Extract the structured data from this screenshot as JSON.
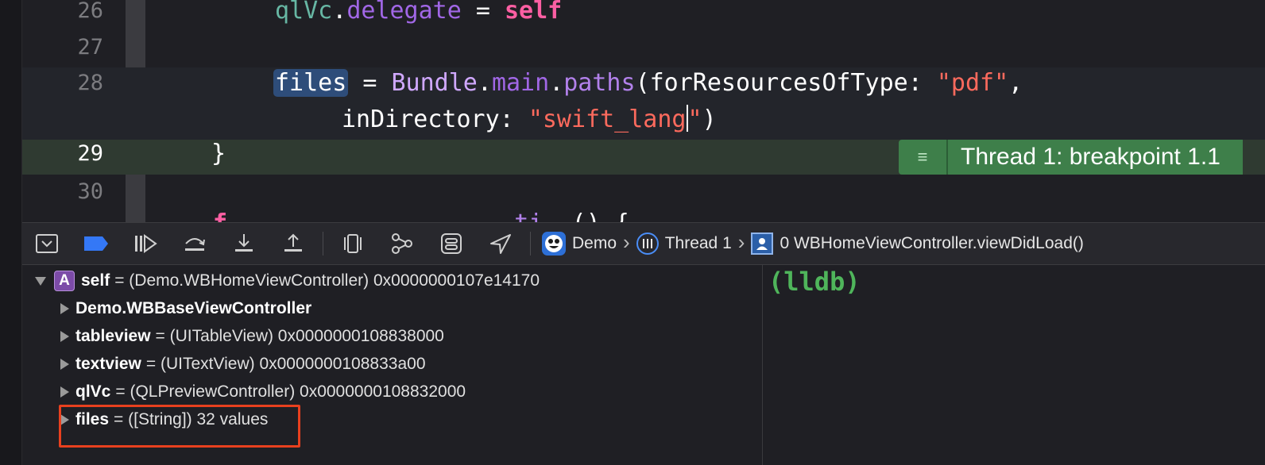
{
  "editor": {
    "lines": [
      {
        "num": "26",
        "tokens": [
          [
            "var",
            "qlVc"
          ],
          [
            "plain",
            "."
          ],
          [
            "prop",
            "delegate"
          ],
          [
            "plain",
            " = "
          ],
          [
            "kw",
            "self"
          ]
        ]
      },
      {
        "num": "27",
        "tokens": []
      },
      {
        "num": "28",
        "tokens": [
          [
            "hlvar",
            "files"
          ],
          [
            "plain",
            " = "
          ],
          [
            "cls",
            "Bundle"
          ],
          [
            "plain",
            "."
          ],
          [
            "prop",
            "main"
          ],
          [
            "plain",
            "."
          ],
          [
            "fn",
            "paths"
          ],
          [
            "plain",
            "(forResourcesOfType: "
          ],
          [
            "str",
            "\"pdf\""
          ],
          [
            "plain",
            ","
          ]
        ]
      },
      {
        "num": "",
        "tokens": [
          [
            "plain",
            "inDirectory: "
          ],
          [
            "str",
            "\"swift_lang"
          ],
          [
            "caret",
            ""
          ],
          [
            "str",
            "\""
          ],
          [
            "plain",
            ")"
          ]
        ]
      },
      {
        "num": "29",
        "tokens": [
          [
            "plain",
            "}"
          ]
        ]
      },
      {
        "num": "30",
        "tokens": []
      },
      {
        "num": "",
        "tokens": [
          [
            "kw",
            "f"
          ],
          [
            "plain",
            "                    "
          ],
          [
            "fn",
            "ti"
          ],
          [
            "plain",
            "  () {"
          ]
        ]
      }
    ],
    "thread_badge": "Thread 1: breakpoint 1.1",
    "colors": {
      "breakpoint": "#3478f6",
      "paused_line": "#2f3a31",
      "badge": "#3e7f4a"
    }
  },
  "debug_bar": {
    "buttons": [
      "hide-debug-area-icon",
      "breakpoints-toggle-icon",
      "continue-icon",
      "step-over-icon",
      "step-into-icon",
      "step-out-icon",
      "view-debugger-icon",
      "memory-graph-icon",
      "environment-overrides-icon",
      "simulate-location-icon"
    ],
    "crumbs": {
      "app": "Demo",
      "thread": "Thread 1",
      "frame": "0 WBHomeViewController.viewDidLoad()"
    }
  },
  "variables": {
    "self": {
      "badge": "A",
      "name": "self",
      "rest": "= (Demo.WBHomeViewController) 0x0000000107e14170"
    },
    "children": [
      {
        "name": "Demo.WBBaseViewController",
        "rest": ""
      },
      {
        "name": "tableview",
        "rest": "= (UITableView) 0x0000000108838000"
      },
      {
        "name": "textview",
        "rest": "= (UITextView) 0x0000000108833a00"
      },
      {
        "name": "qlVc",
        "rest": "= (QLPreviewController) 0x0000000108832000"
      },
      {
        "name": "files",
        "rest": "= ([String]) 32 values"
      }
    ]
  },
  "console": {
    "prompt": "(lldb)"
  }
}
